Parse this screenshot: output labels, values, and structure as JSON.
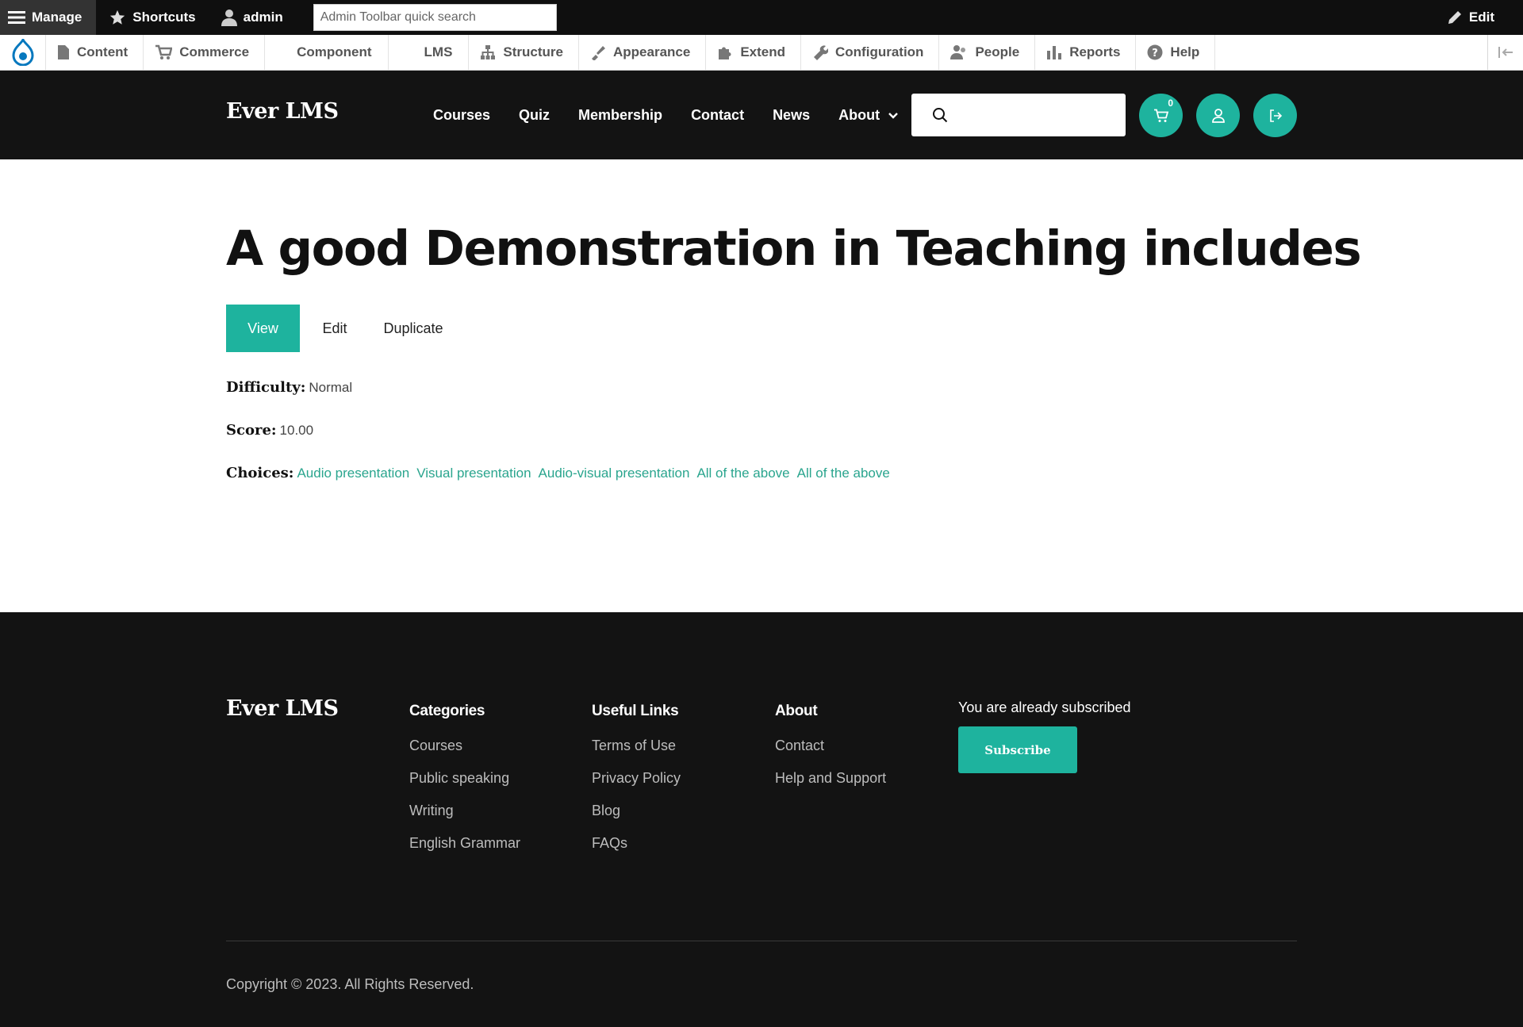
{
  "admin_toolbar": {
    "manage": "Manage",
    "shortcuts": "Shortcuts",
    "user": "admin",
    "search_placeholder": "Admin Toolbar quick search",
    "edit": "Edit"
  },
  "admin_tray": {
    "items": [
      {
        "label": "Content",
        "icon": "page-icon"
      },
      {
        "label": "Commerce",
        "icon": "cart-icon"
      },
      {
        "label": "Component",
        "icon": ""
      },
      {
        "label": "LMS",
        "icon": ""
      },
      {
        "label": "Structure",
        "icon": "sitemap-icon"
      },
      {
        "label": "Appearance",
        "icon": "brush-icon"
      },
      {
        "label": "Extend",
        "icon": "puzzle-icon"
      },
      {
        "label": "Configuration",
        "icon": "wrench-icon"
      },
      {
        "label": "People",
        "icon": "people-icon"
      },
      {
        "label": "Reports",
        "icon": "bar-chart-icon"
      },
      {
        "label": "Help",
        "icon": "help-icon"
      }
    ]
  },
  "header": {
    "logo": "Ever LMS",
    "nav": [
      "Courses",
      "Quiz",
      "Membership",
      "Contact",
      "News",
      "About"
    ],
    "cart_count": "0"
  },
  "page": {
    "title": "A good Demonstration in Teaching includes",
    "tabs": [
      "View",
      "Edit",
      "Duplicate"
    ],
    "difficulty_label": "Difficulty:",
    "difficulty_value": "Normal",
    "score_label": "Score:",
    "score_value": "10.00",
    "choices_label": "Choices:",
    "choices": [
      "Audio presentation",
      "Visual presentation",
      "Audio-visual presentation",
      "All of the above",
      "All of the above"
    ]
  },
  "footer": {
    "logo": "Ever LMS",
    "categories": {
      "title": "Categories",
      "links": [
        "Courses",
        "Public speaking",
        "Writing",
        "English Grammar"
      ]
    },
    "useful_links": {
      "title": "Useful Links",
      "links": [
        "Terms of Use",
        "Privacy Policy",
        "Blog",
        "FAQs"
      ]
    },
    "about": {
      "title": "About",
      "links": [
        "Contact",
        "Help and Support"
      ]
    },
    "subscribed_text": "You are already subscribed",
    "subscribe_button": "Subscribe",
    "copyright": "Copyright © 2023. All Rights Reserved."
  },
  "colors": {
    "accent": "#1eb39e",
    "link": "#2aa58e",
    "dark": "#131313",
    "drupal_blue": "#0678be"
  }
}
